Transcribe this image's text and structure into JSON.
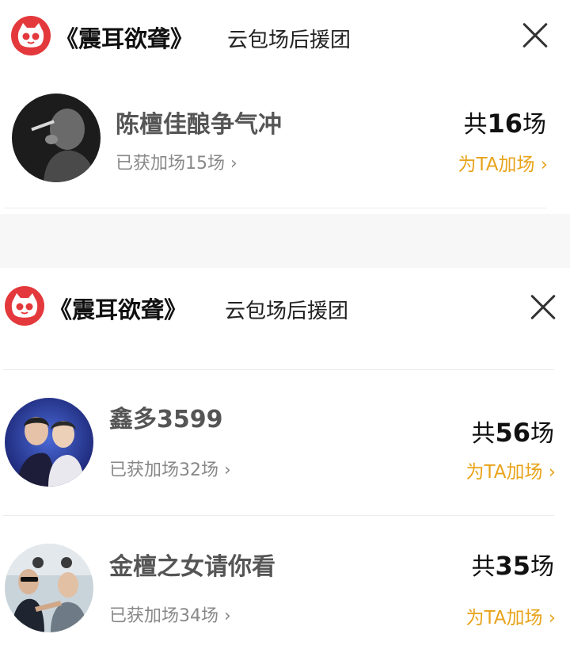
{
  "colors": {
    "brand_red": "#e4393c",
    "accent_orange": "#e8a31a"
  },
  "panels": [
    {
      "title": "《震耳欲聋》",
      "subtitle": "云包场后援团",
      "icons": {
        "logo": "cat-eye-logo-icon",
        "close": "close-icon"
      },
      "fans": [
        {
          "name": "陈檀佳酿争气冲",
          "obtained": "已获加场15场 ›",
          "total_prefix": "共",
          "total_num": "16",
          "total_suffix": "场",
          "add_label": "为TA加场 ›"
        }
      ]
    },
    {
      "title": "《震耳欲聋》",
      "subtitle": "云包场后援团",
      "icons": {
        "logo": "cat-eye-logo-icon",
        "close": "close-icon"
      },
      "fans": [
        {
          "name": "鑫多3599",
          "obtained": "已获加场32场 ›",
          "total_prefix": "共",
          "total_num": "56",
          "total_suffix": "场",
          "add_label": "为TA加场 ›"
        },
        {
          "name": "金檀之女请你看",
          "obtained": "已获加场34场 ›",
          "total_prefix": "共",
          "total_num": "35",
          "total_suffix": "场",
          "add_label": "为TA加场 ›"
        }
      ]
    }
  ]
}
